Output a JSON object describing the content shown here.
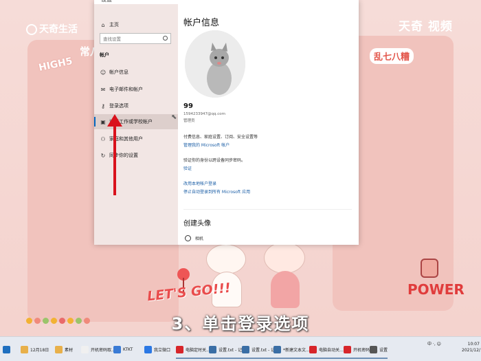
{
  "wallpaper": {
    "watermark_left": "天奇生活",
    "watermark_right": "天奇 视频",
    "sticker_high5": "HIGH5",
    "sticker_chang": "常八",
    "sticker_luan": "乱七八糟",
    "sticker_letsgo": "LET'S GO!!!",
    "sticker_power": "POWER"
  },
  "caption": "3、单击登录选项",
  "window": {
    "title": "设置",
    "nav": {
      "home": "主页",
      "search_placeholder": "查找设置",
      "section": "帐户",
      "items": [
        {
          "label": "帐户信息",
          "icon": "person-icon"
        },
        {
          "label": "电子邮件和帐户",
          "icon": "mail-icon"
        },
        {
          "label": "登录选项",
          "icon": "key-icon"
        },
        {
          "label": "连接工作或学校帐户",
          "icon": "briefcase-icon"
        },
        {
          "label": "家庭和其他用户",
          "icon": "people-icon"
        },
        {
          "label": "同步你的设置",
          "icon": "sync-icon"
        }
      ]
    },
    "content": {
      "title": "帐户信息",
      "account_name": "99",
      "account_email": "1594233947@qq.com",
      "account_role": "管理员",
      "lines": [
        "付费信息、家庭设置、订阅、安全设置等",
        "管理我的 Microsoft 帐户",
        "验证你的身份以跨设备同步密码。",
        "验证",
        "改用本地帐户登录",
        "停止自动登录到所有 Microsoft 应用"
      ],
      "section_avatar": "创建头像",
      "camera_label": "相机"
    }
  },
  "taskbar": {
    "items": [
      {
        "label": "12月18日",
        "color": "#e8b04a"
      },
      {
        "label": "素材",
        "color": "#e8b04a"
      },
      {
        "label": "开机密码取...",
        "color": "#f0f0f0"
      },
      {
        "label": "KTKT",
        "color": "#3a7bd5"
      },
      {
        "label": "我立微口",
        "color": "#2b78e4"
      },
      {
        "label": "电脑定时关...",
        "color": "#d7252a"
      },
      {
        "label": "设置.txt - 记...",
        "color": "#3a6ea5"
      },
      {
        "label": "设置.txt - 记...",
        "color": "#3a6ea5"
      },
      {
        "label": "*新建文本文...",
        "color": "#3a6ea5"
      },
      {
        "label": "电脑自动关...",
        "color": "#d7252a"
      },
      {
        "label": "开机密码取...",
        "color": "#d7252a"
      },
      {
        "label": "设置",
        "color": "#555555"
      }
    ],
    "tray_text": "中 ·, ☺",
    "time": "10:07",
    "date": "2021/12/18"
  }
}
